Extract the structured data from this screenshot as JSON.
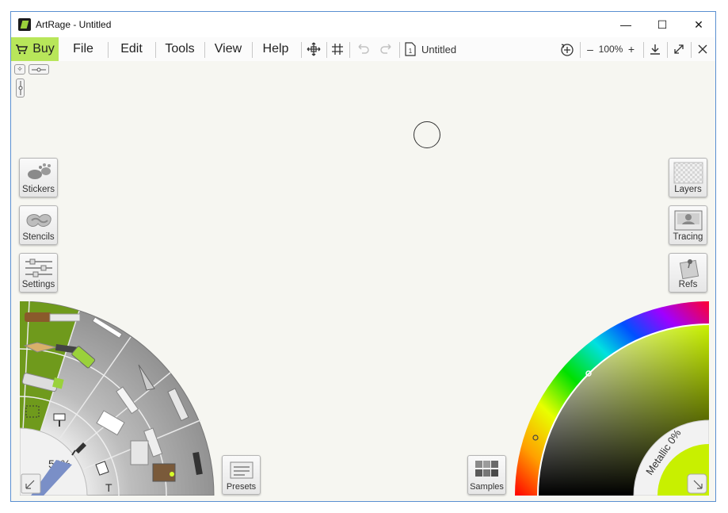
{
  "window": {
    "title": "ArtRage - Untitled"
  },
  "controls": {
    "minimize": "—",
    "maximize": "☐",
    "close": "✕"
  },
  "menu": {
    "buy": "Buy",
    "items": [
      "File",
      "Edit",
      "Tools",
      "View",
      "Help"
    ]
  },
  "toolbar": {
    "doc_name": "Untitled",
    "doc_page": "1",
    "zoom": "100%",
    "zoom_minus": "–",
    "zoom_plus": "+"
  },
  "left_panel": {
    "stickers": "Stickers",
    "stencils": "Stencils",
    "settings": "Settings"
  },
  "right_panel": {
    "layers": "Layers",
    "tracing": "Tracing",
    "refs": "Refs"
  },
  "bottom": {
    "presets": "Presets",
    "samples": "Samples"
  },
  "tool_wheel": {
    "tool_zoom": "50%"
  },
  "color": {
    "metallic": "Metallic 0%",
    "current_hex": "#c8f000",
    "accent_hex": "#6f9a1c"
  }
}
